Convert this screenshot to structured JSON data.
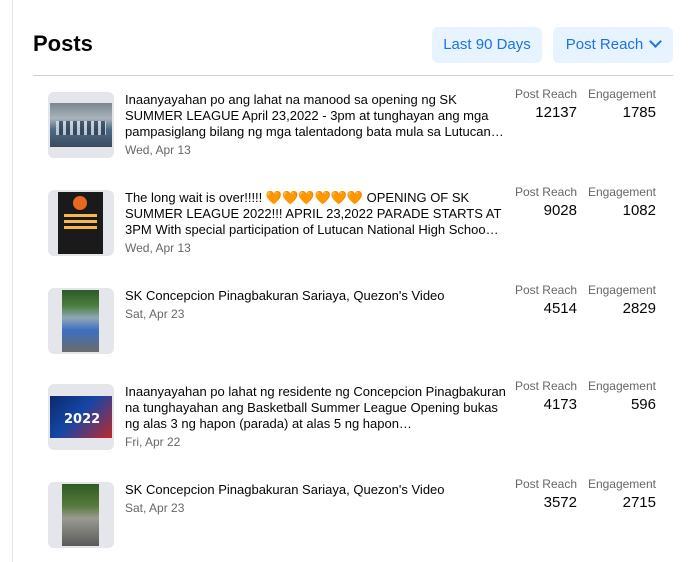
{
  "header": {
    "title": "Posts",
    "range_button": "Last 90 Days",
    "sort_button": "Post Reach"
  },
  "metric_labels": {
    "reach": "Post Reach",
    "engagement": "Engagement"
  },
  "posts": [
    {
      "thumbnail": "crowd-photo",
      "text": "Inaanyayahan po ang lahat na manood sa opening ng SK SUMMER LEAGUE April 23,2022 - 3pm at tunghayan ang mga pampasiglang bilang ng mga talentadong bata mula sa Lutucan…",
      "date": "Wed, Apr 13",
      "reach": "12137",
      "engagement": "1785"
    },
    {
      "thumbnail": "tournament-poster",
      "text": "The long wait is over!!!!! 🧡🧡🧡🧡🧡🧡 OPENING OF SK SUMMER LEAGUE 2022!!! APRIL 23,2022 PARADE STARTS AT 3PM With special participation of Lutucan National High Schoo…",
      "date": "Wed, Apr 13",
      "reach": "9028",
      "engagement": "1082"
    },
    {
      "thumbnail": "court-video",
      "text": "SK Concepcion Pinagbakuran Sariaya, Quezon's Video",
      "date": "Sat, Apr 23",
      "reach": "4514",
      "engagement": "2829"
    },
    {
      "thumbnail": "summer-league-banner",
      "text": "Inaanyayahan po lahat ng residente ng Concepcion Pinagbakuran na tunghayahan ang Basketball Summer League Opening bukas ng alas 3 ng hapon (parada) at alas 5 ng hapon…",
      "date": "Fri, Apr 22",
      "reach": "4173",
      "engagement": "596"
    },
    {
      "thumbnail": "court-video",
      "text": "SK Concepcion Pinagbakuran Sariaya, Quezon's Video",
      "date": "Sat, Apr 23",
      "reach": "3572",
      "engagement": "2715"
    }
  ]
}
